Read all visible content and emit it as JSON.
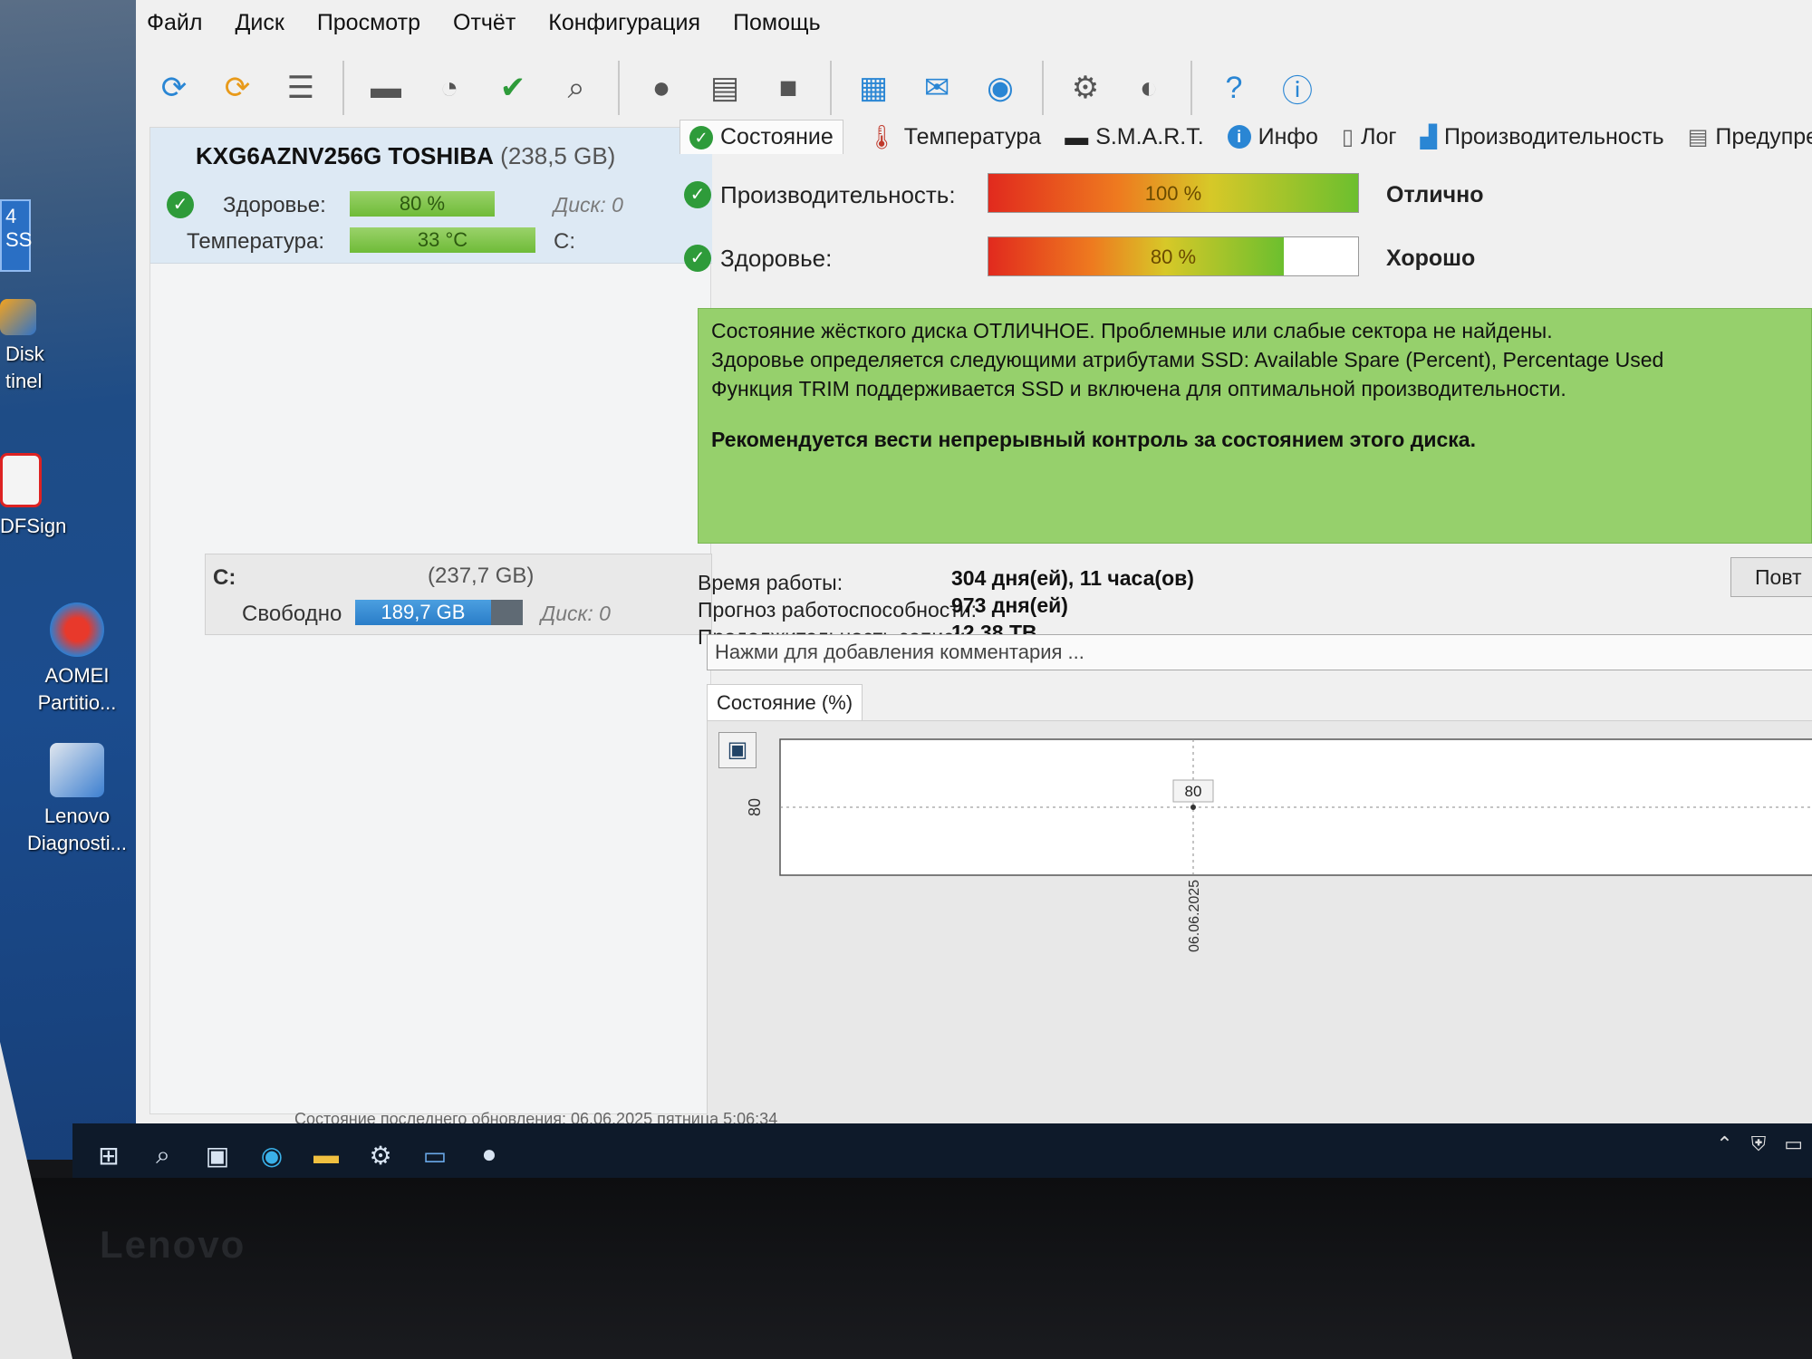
{
  "desktop": {
    "peek_text": "4\nSS",
    "icons": [
      {
        "label": "Disk\ntinel"
      },
      {
        "label": "DFSign"
      },
      {
        "label": "AOMEI\nPartitio..."
      },
      {
        "label": "Lenovo\nDiagnosti..."
      }
    ]
  },
  "menu": [
    "Файл",
    "Диск",
    "Просмотр",
    "Отчёт",
    "Конфигурация",
    "Помощь"
  ],
  "disk": {
    "name": "KXG6AZNV256G TOSHIBA",
    "size": "(238,5 GB)",
    "health_label": "Здоровье:",
    "health_value": "80 %",
    "health_level": 80,
    "disk_label": "Диск: 0",
    "temp_label": "Температура:",
    "temp_value": "33 °C",
    "drive_letter": "C:"
  },
  "volume": {
    "letter": "C:",
    "size": "(237,7 GB)",
    "free_label": "Свободно",
    "free_value": "189,7 GB",
    "disk_label": "Диск: 0"
  },
  "tabs": [
    "Состояние",
    "Температура",
    "S.M.A.R.T.",
    "Инфо",
    "Лог",
    "Производительность",
    "Предупреж"
  ],
  "performance": {
    "label": "Производительность:",
    "value": "100 %",
    "level": 100,
    "verdict": "Отлично"
  },
  "health": {
    "label": "Здоровье:",
    "value": "80 %",
    "level": 80,
    "verdict": "Хорошо"
  },
  "status_lines": [
    "Состояние жёсткого диска ОТЛИЧНОЕ. Проблемные или слабые сектора не найдены.",
    "Здоровье определяется следующими атрибутами SSD: Available Spare (Percent), Percentage Used",
    "Функция TRIM поддерживается SSD и включена для оптимальной производительности."
  ],
  "status_recommendation": "Рекомендуется вести непрерывный контроль за состоянием этого диска.",
  "info": {
    "uptime_label": "Время работы:",
    "uptime_value": "304 дня(ей), 11 часа(ов)",
    "forecast_label": "Прогноз работоспособности:",
    "forecast_value": "973 дня(ей)",
    "write_label": "Продолжительность записи:",
    "write_value": "12,38 TB",
    "repeat_button": "Повт"
  },
  "comment_placeholder": "Нажми для добавления комментария ...",
  "chart_tab": "Состояние (%)",
  "chart_data": {
    "type": "line",
    "x": [
      "06.06.2025"
    ],
    "series": [
      {
        "values": [
          80
        ]
      }
    ],
    "ylabel": "",
    "xlabel": "",
    "yticks": [
      "80"
    ],
    "data_labels": [
      "80"
    ]
  },
  "statusline": "Состояние последнего обновления: 06.06.2025 пятница 5:06:34",
  "brand": "Lenovo",
  "colors": {
    "ok_green": "#2e9b3a",
    "status_bg": "#96d06c",
    "bar_green": "#7cc246",
    "bar_blue": "#3b8fd6"
  }
}
